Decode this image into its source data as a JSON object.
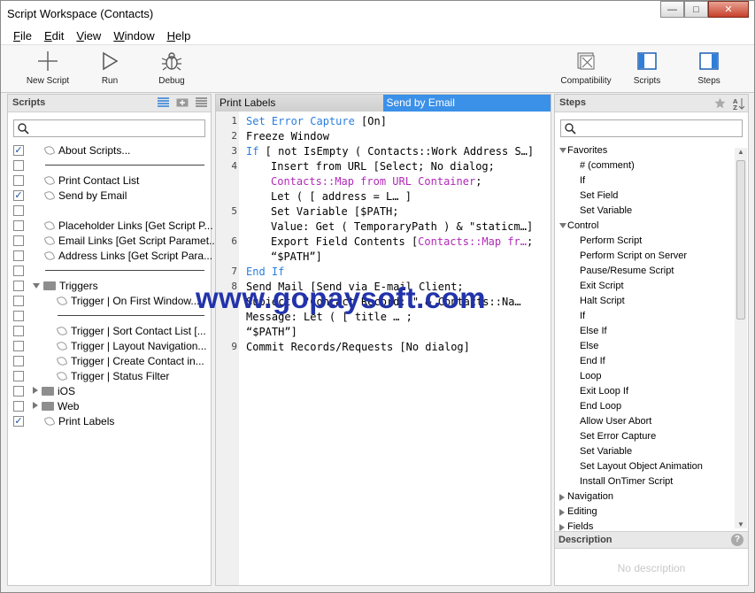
{
  "window": {
    "title": "Script Workspace (Contacts)",
    "minimize": "—",
    "maximize": "□",
    "close": "✕"
  },
  "menu": [
    {
      "u": "F",
      "rest": "ile"
    },
    {
      "u": "E",
      "rest": "dit"
    },
    {
      "u": "V",
      "rest": "iew"
    },
    {
      "u": "W",
      "rest": "indow"
    },
    {
      "u": "H",
      "rest": "elp"
    }
  ],
  "toolbar": {
    "new_script": "New Script",
    "run": "Run",
    "debug": "Debug",
    "compatibility": "Compatibility",
    "scripts": "Scripts",
    "steps": "Steps"
  },
  "scripts_panel": {
    "title": "Scripts",
    "rows": [
      {
        "checked": true,
        "type": "script",
        "label": "About Scripts..."
      },
      {
        "checked": false,
        "type": "separator"
      },
      {
        "checked": false,
        "type": "script",
        "label": "Print Contact List"
      },
      {
        "checked": true,
        "type": "script",
        "label": "Send by Email"
      },
      {
        "checked": false,
        "type": "blank"
      },
      {
        "checked": false,
        "type": "script",
        "label": "Placeholder Links [Get Script P..."
      },
      {
        "checked": false,
        "type": "script",
        "label": "Email Links [Get Script Paramet..."
      },
      {
        "checked": false,
        "type": "script",
        "label": "Address Links [Get Script Para..."
      },
      {
        "checked": false,
        "type": "separator"
      },
      {
        "checked": false,
        "type": "folder-open",
        "label": "Triggers"
      },
      {
        "checked": false,
        "type": "child",
        "label": "Trigger | On First Window..."
      },
      {
        "checked": false,
        "type": "child-separator"
      },
      {
        "checked": false,
        "type": "child",
        "label": "Trigger | Sort Contact List [..."
      },
      {
        "checked": false,
        "type": "child",
        "label": "Trigger | Layout Navigation..."
      },
      {
        "checked": false,
        "type": "child",
        "label": "Trigger | Create Contact in..."
      },
      {
        "checked": false,
        "type": "child",
        "label": "Trigger | Status Filter"
      },
      {
        "checked": false,
        "type": "folder-closed",
        "label": "iOS"
      },
      {
        "checked": false,
        "type": "folder-closed",
        "label": "Web"
      },
      {
        "checked": true,
        "type": "script",
        "label": "Print Labels"
      }
    ]
  },
  "editor": {
    "tabs": [
      "Print Labels",
      "Send by Email"
    ],
    "lines": [
      {
        "n": "1",
        "indent": 0,
        "parts": [
          [
            "kw",
            "Set Error Capture"
          ],
          [
            "",
            "  [On]"
          ]
        ]
      },
      {
        "n": "2",
        "indent": 0,
        "parts": [
          [
            "",
            "Freeze Window"
          ]
        ]
      },
      {
        "n": "3",
        "indent": 0,
        "parts": [
          [
            "kw",
            "If"
          ],
          [
            "",
            " [ not IsEmpty ( Contacts::Work Address S…]"
          ]
        ]
      },
      {
        "n": "4",
        "indent": 1,
        "parts": [
          [
            "",
            "Insert from URL [Select; No dialog;"
          ]
        ]
      },
      {
        "n": "",
        "indent": 1,
        "parts": [
          [
            "fld",
            "Contacts::Map from URL Container"
          ],
          [
            "",
            ";"
          ]
        ]
      },
      {
        "n": "",
        "indent": 1,
        "parts": [
          [
            "",
            "Let    (      [      address =      L… ]"
          ]
        ]
      },
      {
        "n": "5",
        "indent": 1,
        "parts": [
          [
            "",
            "Set Variable [$PATH;"
          ]
        ]
      },
      {
        "n": "",
        "indent": 1,
        "parts": [
          [
            "",
            "Value: Get ( TemporaryPath ) & \"staticm…]"
          ]
        ]
      },
      {
        "n": "6",
        "indent": 1,
        "parts": [
          [
            "",
            "Export Field Contents ["
          ],
          [
            "fld",
            "Contacts::Map fr…"
          ],
          [
            "",
            ";"
          ]
        ]
      },
      {
        "n": "",
        "indent": 1,
        "parts": [
          [
            "",
            "“$PATH”]"
          ]
        ]
      },
      {
        "n": "7",
        "indent": 0,
        "parts": [
          [
            "kw",
            "End If"
          ]
        ]
      },
      {
        "n": "8",
        "indent": 0,
        "parts": [
          [
            "",
            "Send Mail [Send via E-mail Client;"
          ]
        ]
      },
      {
        "n": "",
        "indent": 0,
        "parts": [
          [
            "",
            "Subject: \"Contact Record: \" & Contacts::Na…"
          ]
        ]
      },
      {
        "n": "",
        "indent": 0,
        "parts": [
          [
            "",
            "Message: Let   (       [       title  …     ;"
          ]
        ]
      },
      {
        "n": "",
        "indent": 0,
        "parts": [
          [
            "",
            "“$PATH”]"
          ]
        ]
      },
      {
        "n": "9",
        "indent": 0,
        "parts": [
          [
            "",
            "Commit Records/Requests [No dialog]"
          ]
        ]
      }
    ],
    "watermark": "www.gopaysoft.com"
  },
  "steps_panel": {
    "title": "Steps",
    "items": [
      {
        "kind": "cat-open",
        "label": "Favorites"
      },
      {
        "kind": "item",
        "label": "# (comment)"
      },
      {
        "kind": "item",
        "label": "If"
      },
      {
        "kind": "item",
        "label": "Set Field"
      },
      {
        "kind": "item",
        "label": "Set Variable"
      },
      {
        "kind": "cat-open",
        "label": "Control"
      },
      {
        "kind": "item",
        "label": "Perform Script"
      },
      {
        "kind": "item",
        "label": "Perform Script on Server"
      },
      {
        "kind": "item",
        "label": "Pause/Resume Script"
      },
      {
        "kind": "item",
        "label": "Exit Script"
      },
      {
        "kind": "item",
        "label": "Halt Script"
      },
      {
        "kind": "item",
        "label": "If"
      },
      {
        "kind": "item",
        "label": "Else If"
      },
      {
        "kind": "item",
        "label": "Else"
      },
      {
        "kind": "item",
        "label": "End If"
      },
      {
        "kind": "item",
        "label": "Loop"
      },
      {
        "kind": "item",
        "label": "Exit Loop If"
      },
      {
        "kind": "item",
        "label": "End Loop"
      },
      {
        "kind": "item",
        "label": "Allow User Abort"
      },
      {
        "kind": "item",
        "label": "Set Error Capture"
      },
      {
        "kind": "item",
        "label": "Set Variable"
      },
      {
        "kind": "item",
        "label": "Set Layout Object Animation"
      },
      {
        "kind": "item",
        "label": "Install OnTimer Script"
      },
      {
        "kind": "cat-closed",
        "label": "Navigation"
      },
      {
        "kind": "cat-closed",
        "label": "Editing"
      },
      {
        "kind": "cat-closed",
        "label": "Fields"
      }
    ],
    "description_title": "Description",
    "description_help": "?",
    "description_body": "No description"
  },
  "colors": {
    "keyword": "#2a7ee0",
    "field": "#b02ab8",
    "active_tab": "#3b90e8",
    "watermark": "#2233aa"
  }
}
